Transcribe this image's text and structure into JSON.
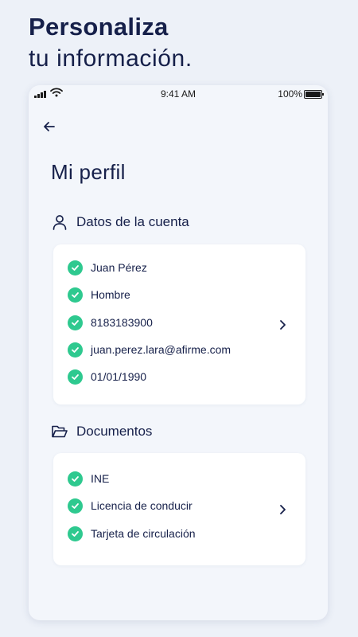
{
  "headline": {
    "line1": "Personaliza",
    "line2": "tu información."
  },
  "status_bar": {
    "time": "9:41 AM",
    "battery": "100%"
  },
  "profile": {
    "title": "Mi perfil",
    "account": {
      "heading": "Datos de la cuenta",
      "items": [
        "Juan Pérez",
        "Hombre",
        "8183183900",
        "juan.perez.lara@afirme.com",
        "01/01/1990"
      ]
    },
    "documents": {
      "heading": "Documentos",
      "items": [
        "INE",
        "Licencia de conducir",
        "Tarjeta de circulación"
      ]
    }
  },
  "colors": {
    "accent_check": "#2ec98f",
    "text_primary": "#16204a",
    "background": "#edf1f8"
  },
  "icons": [
    "back-arrow-icon",
    "user-icon",
    "folder-icon",
    "check-icon",
    "chevron-right-icon",
    "signal-icon",
    "wifi-icon",
    "battery-icon"
  ]
}
